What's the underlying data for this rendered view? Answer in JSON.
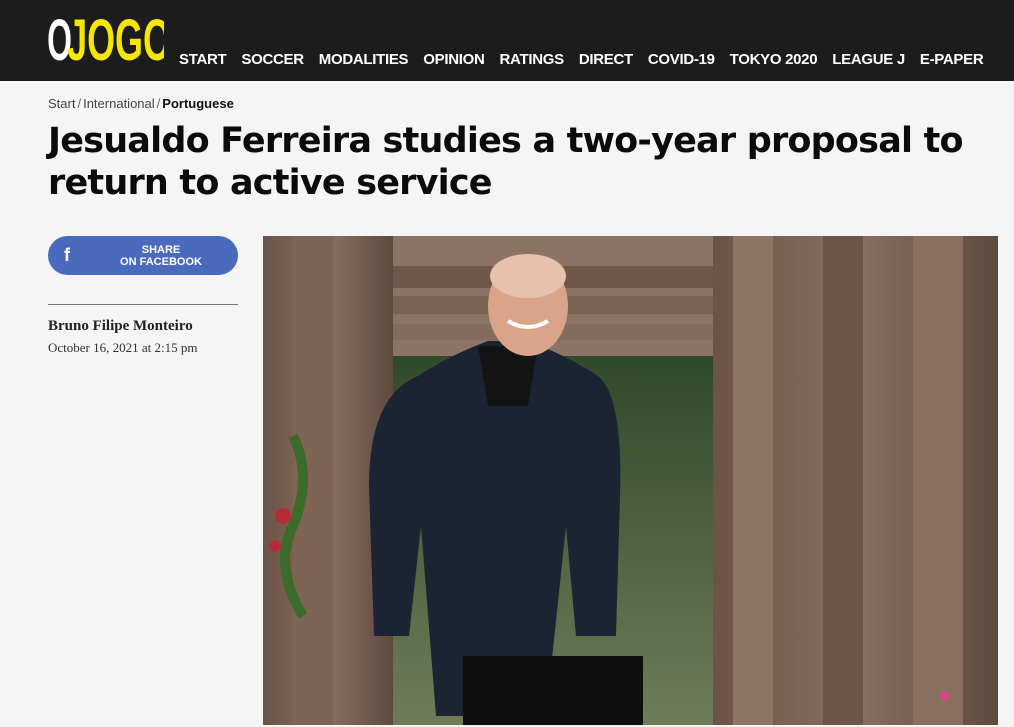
{
  "header": {
    "logo_text": "OJOGO",
    "nav": [
      "START",
      "SOCCER",
      "MODALITIES",
      "OPINION",
      "RATINGS",
      "DIRECT",
      "COVID-19",
      "TOKYO 2020",
      "LEAGUE J",
      "E-PAPER"
    ]
  },
  "breadcrumb": {
    "items": [
      "Start",
      "International",
      "Portuguese"
    ]
  },
  "article": {
    "title": "Jesualdo Ferreira studies a two-year proposal to return to active service",
    "author": "Bruno Filipe Monteiro",
    "date": "October 16, 2021 at 2:15 pm"
  },
  "share": {
    "icon": "facebook-icon",
    "line1": "SHARE",
    "line2": "ON FACEBOOK"
  },
  "colors": {
    "header_bg": "#1c1c1c",
    "logo_yellow": "#f6e600",
    "facebook_blue": "#4a6bbd",
    "page_bg": "#f5f5f5"
  }
}
